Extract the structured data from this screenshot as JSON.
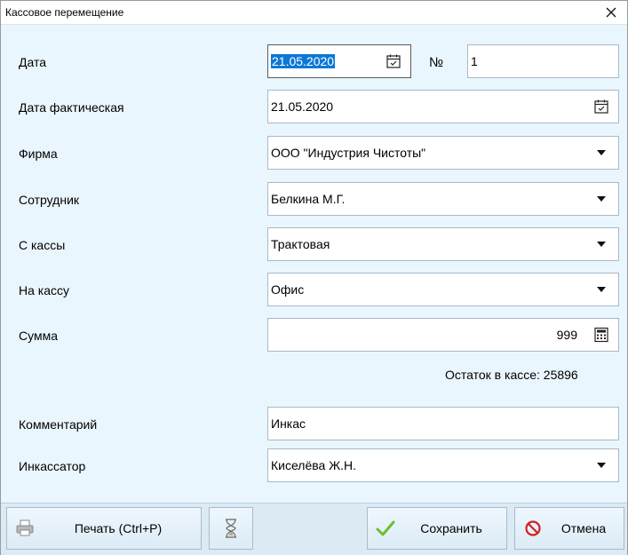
{
  "window": {
    "title": "Кассовое перемещение"
  },
  "fields": {
    "date": {
      "label": "Дата",
      "value": "21.05.2020"
    },
    "number": {
      "label": "№",
      "value": "1"
    },
    "actual_date": {
      "label": "Дата фактическая",
      "value": "21.05.2020"
    },
    "firm": {
      "label": "Фирма",
      "value": "ООО \"Индустрия Чистоты\""
    },
    "employee": {
      "label": "Сотрудник",
      "value": "Белкина М.Г."
    },
    "from_cash": {
      "label": "С кассы",
      "value": "Трактовая"
    },
    "to_cash": {
      "label": "На кассу",
      "value": "Офис"
    },
    "amount": {
      "label": "Сумма",
      "value": "999"
    },
    "balance": {
      "text": "Остаток в кассе: 25896"
    },
    "comment": {
      "label": "Комментарий",
      "value": "Инкас"
    },
    "collector": {
      "label": "Инкассатор",
      "value": "Киселёва Ж.Н."
    }
  },
  "buttons": {
    "print": "Печать (Ctrl+P)",
    "save": "Сохранить",
    "cancel": "Отмена"
  },
  "icons": {
    "calendar": "calendar-icon",
    "dropdown": "chevron-down-icon",
    "calculator": "calculator-icon",
    "printer": "printer-icon",
    "hourglass": "hourglass-icon",
    "check": "check-icon",
    "cancel": "cancel-icon",
    "close": "close-icon"
  },
  "colors": {
    "background": "#eaf6fd",
    "selection": "#0a78d7",
    "check": "#6cbf2c",
    "cancel": "#d12020"
  }
}
